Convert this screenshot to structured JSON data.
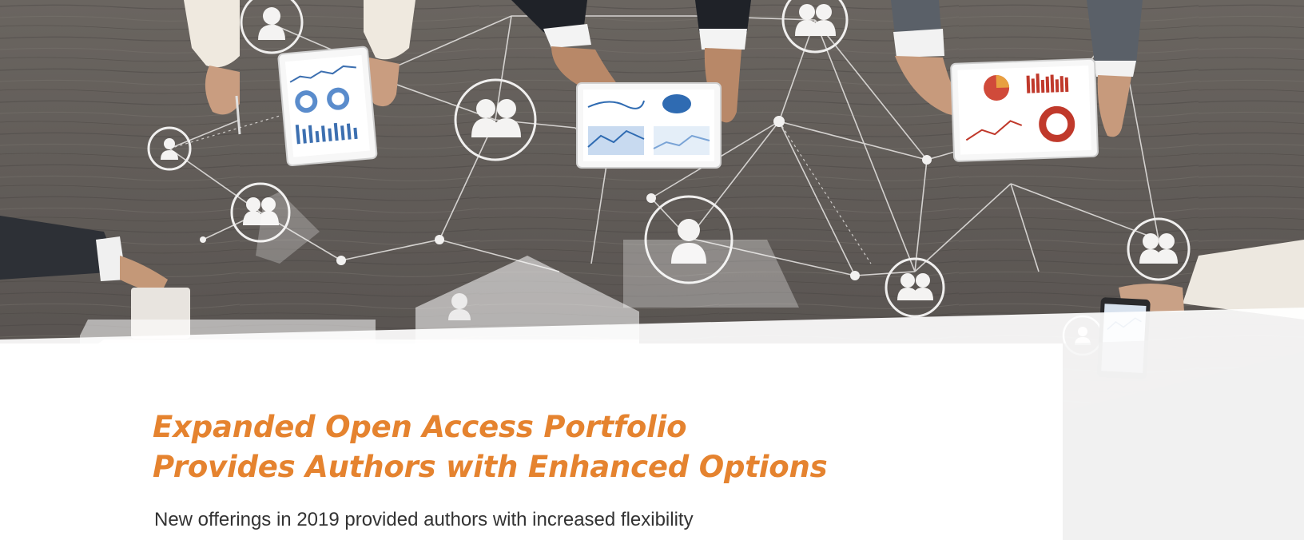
{
  "article": {
    "headline_line1": "Expanded Open Access Portfolio",
    "headline_line2": "Provides Authors with Enhanced Options",
    "body_line1": "New offerings in 2019 provided authors with increased flexibility"
  },
  "colors": {
    "headline": "#e5832f",
    "body_text": "#333333",
    "table_wood": "#5e5955",
    "overlay": "#ffffff"
  },
  "hero_image": {
    "subject": "people at a wooden table with tablets and charts, connected by a network of user icons",
    "icons": [
      "user-icon",
      "user-group-icon",
      "tablet-icon",
      "chart-icon"
    ]
  }
}
